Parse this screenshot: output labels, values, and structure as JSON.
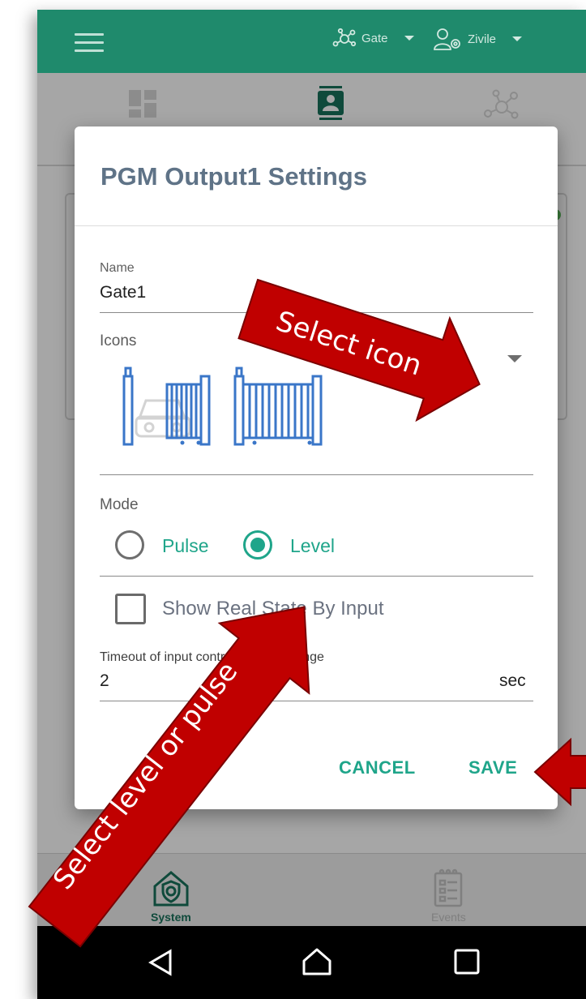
{
  "appbar": {
    "device_label": "Gate",
    "user_label": "Zivile",
    "colors": {
      "bar": "#1f8a6c",
      "accent": "#1fa58a"
    }
  },
  "tabs": {
    "icons": [
      "dashboard-icon",
      "contact-card-icon",
      "network-icon"
    ]
  },
  "dialog": {
    "title": "PGM Output1 Settings",
    "name_label": "Name",
    "name_value": "Gate1",
    "icons_label": "Icons",
    "mode_label": "Mode",
    "mode_options": [
      "Pulse",
      "Level"
    ],
    "mode_selected": "Level",
    "checkbox_label": "Show Real State By Input",
    "checkbox_checked": false,
    "timeout_label": "Timeout of input control Status Change",
    "timeout_value": "2",
    "timeout_unit": "sec",
    "cancel": "CANCEL",
    "save": "SAVE"
  },
  "bottom_nav": {
    "system": "System",
    "events": "Events"
  },
  "annotations": {
    "select_icon": "Select icon",
    "select_mode": "Select level or pulse",
    "arrow_color": "#c00000"
  }
}
